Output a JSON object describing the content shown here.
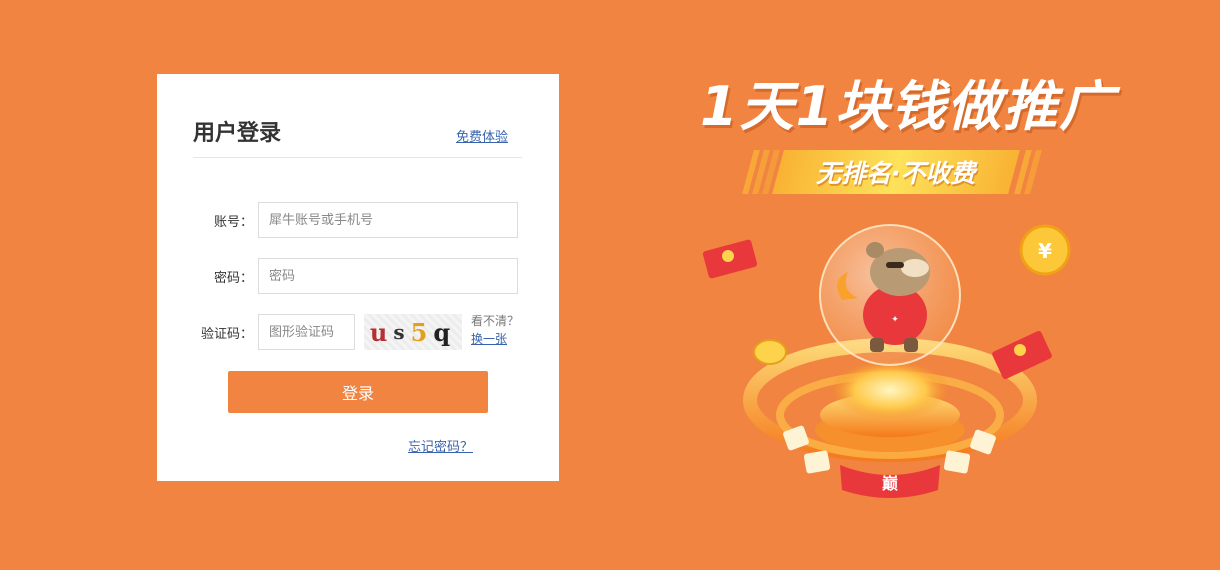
{
  "login": {
    "title": "用户登录",
    "trial_link": "免费体验",
    "account": {
      "label": "账号：",
      "placeholder": "犀牛账号或手机号",
      "value": ""
    },
    "password": {
      "label": "密码：",
      "placeholder": "密码",
      "value": ""
    },
    "captcha": {
      "label": "验证码：",
      "placeholder": "图形验证码",
      "value": "",
      "image_chars": [
        "u",
        "s",
        "5",
        "q"
      ],
      "hint": "看不清？",
      "refresh": "换一张"
    },
    "submit": "登录",
    "forgot": "忘记密码？"
  },
  "promo": {
    "headline": "1天1块钱做推广",
    "banner": "无排名·不收费",
    "mascot_badge": "巅"
  },
  "colors": {
    "background": "#f08440",
    "accent": "#f08440",
    "link": "#3a63ad",
    "card": "#ffffff"
  },
  "icons": [
    "captcha-image",
    "mascot-illustration",
    "coin-icon",
    "red-envelope-icon"
  ]
}
